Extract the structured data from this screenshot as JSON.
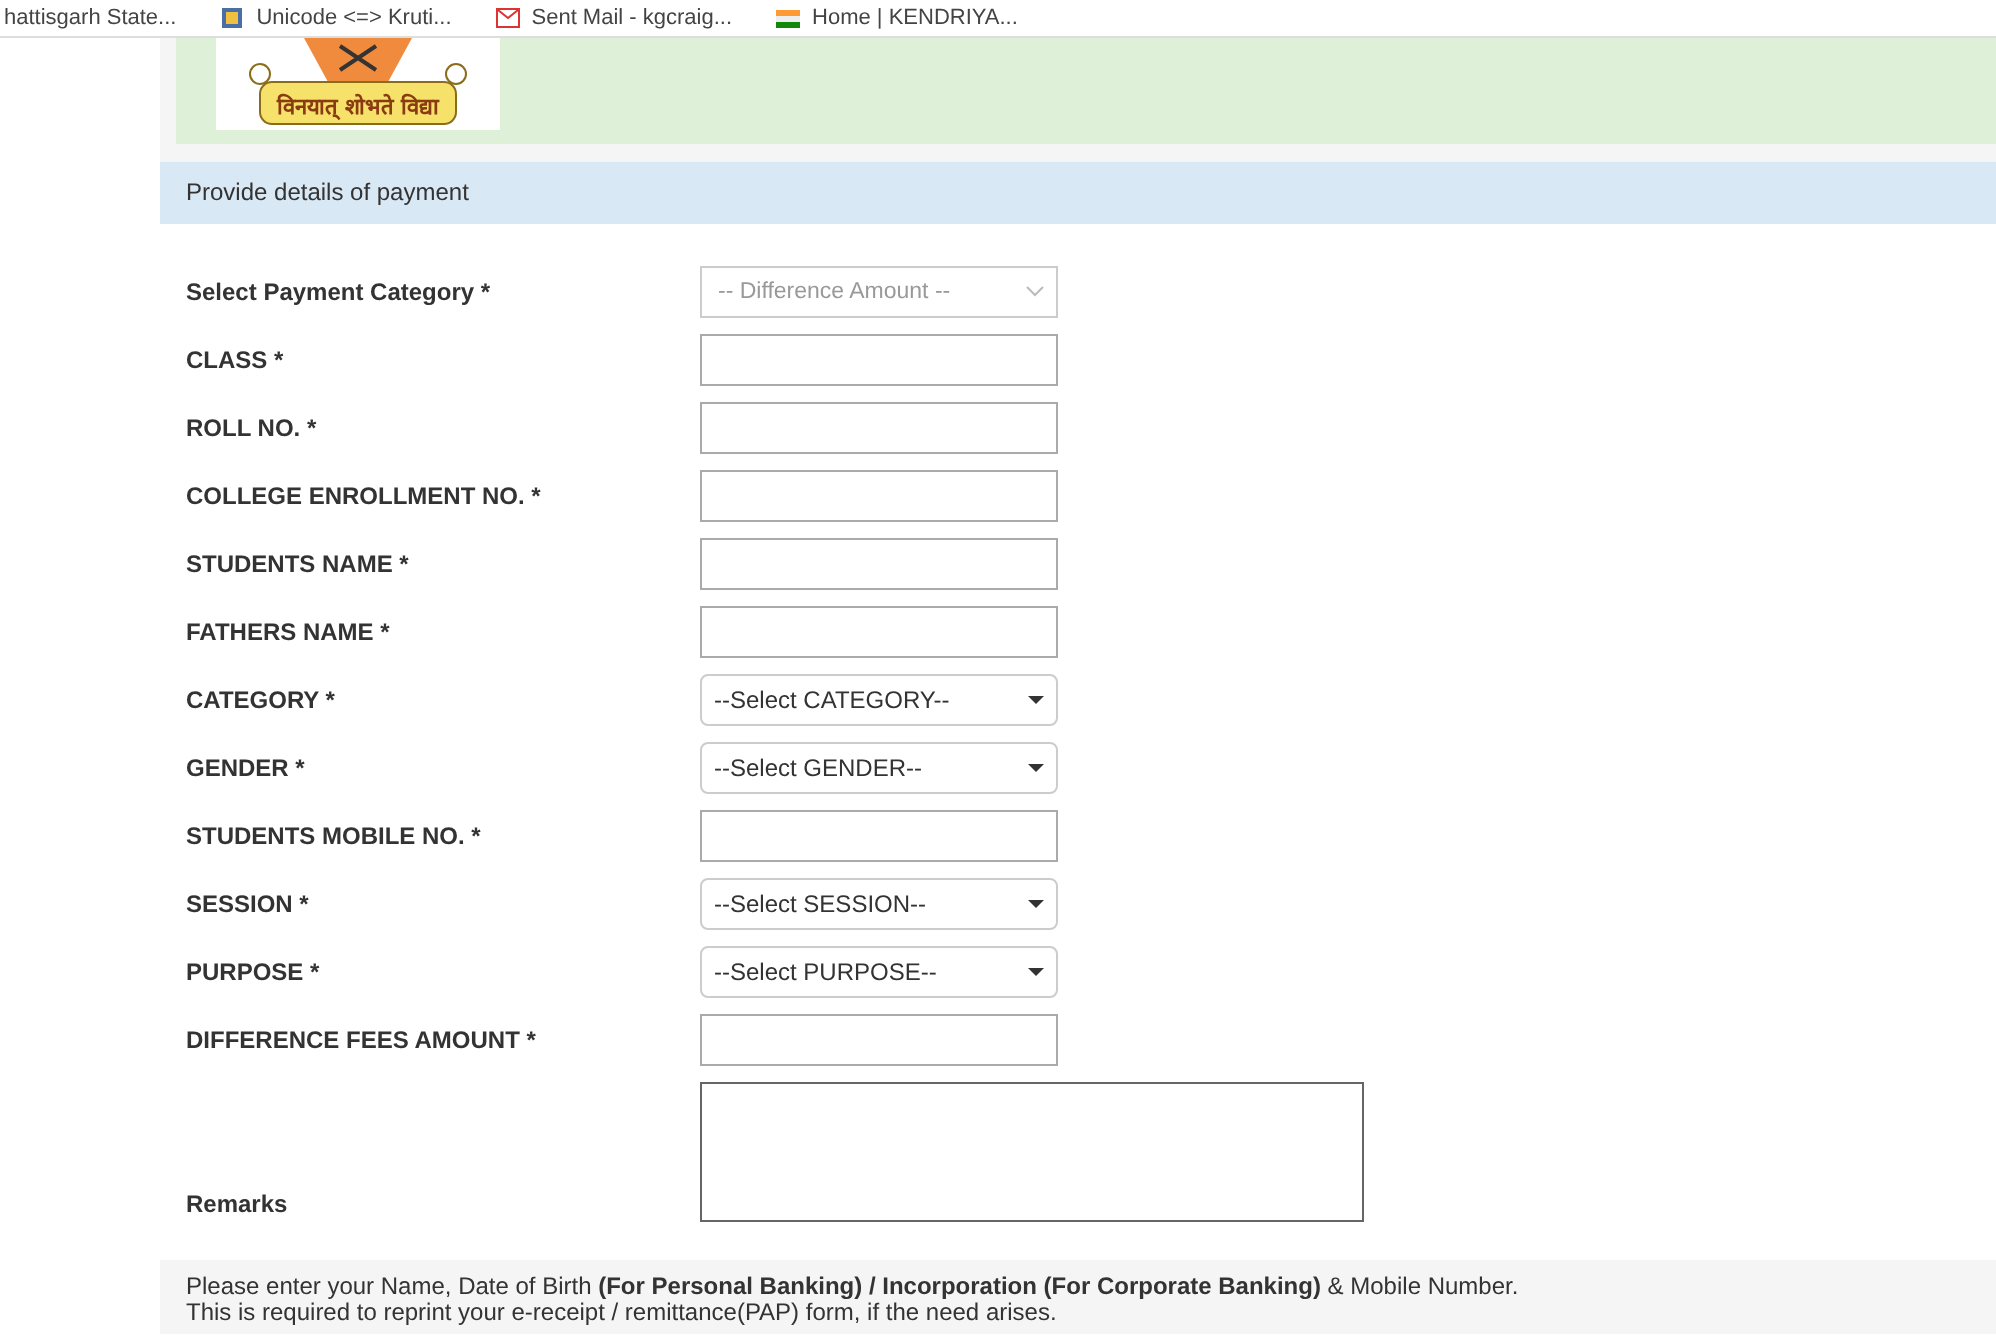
{
  "bookmarks": [
    {
      "label": "hattisgarh State...",
      "kind": "plain"
    },
    {
      "label": "Unicode <=> Kruti...",
      "kind": "doc"
    },
    {
      "label": "Sent Mail - kgcraig...",
      "kind": "mail"
    },
    {
      "label": "Home | KENDRIYA...",
      "kind": "flag"
    }
  ],
  "banner": {
    "motto": "विनयात् शोभते विद्या"
  },
  "section_header": "Provide details of payment",
  "fields": [
    {
      "label": "Select Payment Category *",
      "kind": "select",
      "value": "-- Difference Amount --",
      "disabled": true
    },
    {
      "label": "CLASS *",
      "kind": "text"
    },
    {
      "label": "ROLL NO. *",
      "kind": "text"
    },
    {
      "label": "COLLEGE ENROLLMENT NO. *",
      "kind": "text"
    },
    {
      "label": "STUDENTS NAME *",
      "kind": "text"
    },
    {
      "label": "FATHERS NAME *",
      "kind": "text"
    },
    {
      "label": "CATEGORY *",
      "kind": "select",
      "value": "--Select CATEGORY--",
      "disabled": false
    },
    {
      "label": "GENDER *",
      "kind": "select",
      "value": "--Select GENDER--",
      "disabled": false
    },
    {
      "label": "STUDENTS MOBILE NO. *",
      "kind": "text"
    },
    {
      "label": "SESSION *",
      "kind": "select",
      "value": "--Select SESSION--",
      "disabled": false
    },
    {
      "label": "PURPOSE *",
      "kind": "select",
      "value": "--Select PURPOSE--",
      "disabled": false
    },
    {
      "label": "DIFFERENCE FEES AMOUNT *",
      "kind": "text"
    },
    {
      "label": "Remarks",
      "kind": "textarea"
    }
  ],
  "note": [
    "Please enter your Name, Date of Birth **(For Personal Banking) / Incorporation (For Corporate Banking)**  & Mobile Number.",
    "This is required to reprint your e-receipt / remittance(PAP) form, if the need arises."
  ]
}
